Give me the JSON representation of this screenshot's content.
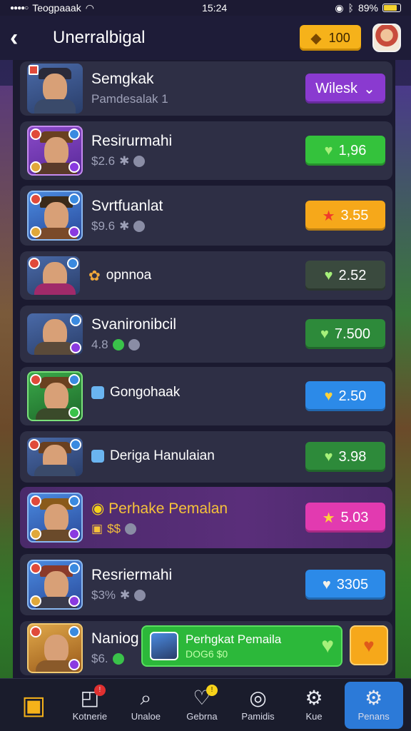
{
  "status_bar": {
    "carrier": "Teogpaaak",
    "time": "15:24",
    "battery": "89%"
  },
  "header": {
    "title": "Unerralbigal",
    "coins": "100"
  },
  "rows": [
    {
      "name": "Semgkak",
      "sub": "Pamdesalak 1",
      "button": "Wilesk",
      "button_icon": "chevron-down-icon"
    },
    {
      "name": "Resirurmahi",
      "sub": "$2.6",
      "button": "1,96",
      "button_icon": "heart-icon"
    },
    {
      "name": "Svrtfuanlat",
      "sub": "$9.6",
      "button": "3.55",
      "button_icon": "star-icon"
    },
    {
      "name": "opnnoa",
      "button": "2.52",
      "button_icon": "heart-icon"
    },
    {
      "name": "Svanironibcil",
      "sub": "4.8",
      "button": "7.500",
      "button_icon": "heart-icon"
    },
    {
      "name": "Gongohaak",
      "button": "2.50",
      "button_icon": "heart-icon"
    },
    {
      "name": "Deriga Hanulaian",
      "button": "3.98",
      "button_icon": "heart-icon"
    },
    {
      "name": "Perhake Pemalan",
      "sub": "$$",
      "button": "5.03",
      "button_icon": "star-icon"
    },
    {
      "name": "Resriermahi",
      "sub": "$3%",
      "button": "3305",
      "button_icon": "heart-icon"
    },
    {
      "name": "Naniog",
      "sub": "$6.",
      "promo_title": "Perhgkat Pemaila",
      "promo_sub": "DOG6 $0"
    }
  ],
  "tabs": [
    {
      "label": ""
    },
    {
      "label": "Kotnerie"
    },
    {
      "label": "Unaloe"
    },
    {
      "label": "Gebrna"
    },
    {
      "label": "Pamidis"
    },
    {
      "label": "Kue"
    },
    {
      "label": "Penans"
    }
  ],
  "colors": {
    "accent": "#2c7ad8",
    "coin": "#f6b21a",
    "green": "#34c23c",
    "purple": "#8a3ad0"
  }
}
